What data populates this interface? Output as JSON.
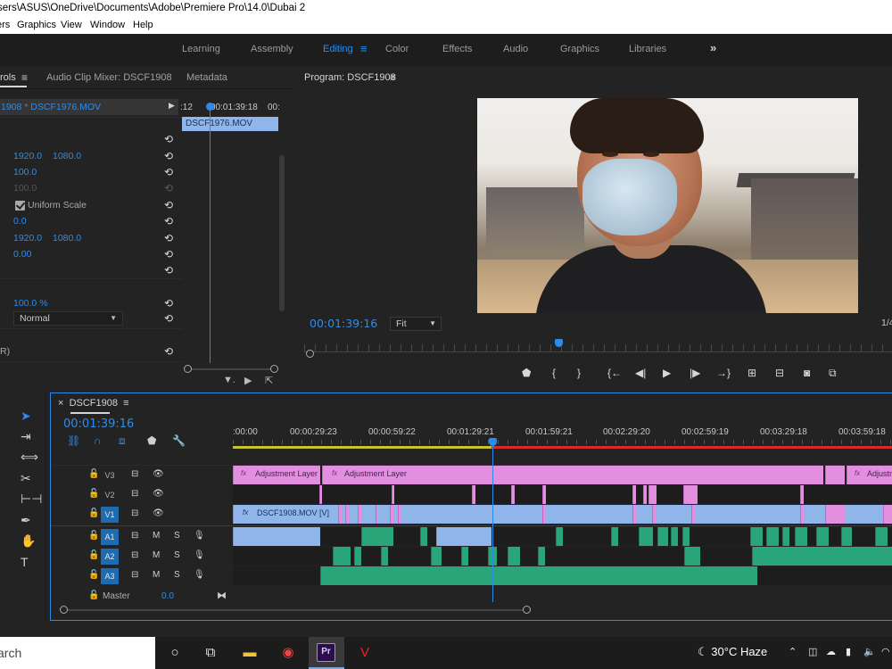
{
  "window": {
    "title": "sers\\ASUS\\OneDrive\\Documents\\Adobe\\Premiere Pro\\14.0\\Dubai 2"
  },
  "menu": [
    "ers",
    "Graphics",
    "View",
    "Window",
    "Help"
  ],
  "workspaces": {
    "tabs": [
      "Learning",
      "Assembly",
      "Editing",
      "Color",
      "Effects",
      "Audio",
      "Graphics",
      "Libraries"
    ],
    "active": "Editing",
    "more": "»"
  },
  "effect_controls": {
    "tab_label": "rols",
    "tabs": [
      "Audio Clip Mixer: DSCF1908",
      "Metadata"
    ],
    "clip_header": "1908 * DSCF1976.MOV",
    "position": [
      "1920.0",
      "1080.0"
    ],
    "scale": "100.0",
    "scale_width": "100.0",
    "uniform_scale": "Uniform Scale",
    "rotation": "0.0",
    "anchor": [
      "1920.0",
      "1080.0"
    ],
    "anti_flicker": "0.00",
    "opacity": "100.0 %",
    "blend_mode": "Normal",
    "bottom_label": "R)",
    "mini_timeline": {
      "labels": [
        ":12",
        "00:01:39:18",
        "00:"
      ],
      "clip": "DSCF1976.MOV"
    }
  },
  "program_monitor": {
    "title": "Program: DSCF1908",
    "timecode": "00:01:39:16",
    "zoom": "Fit",
    "fraction": "1/4"
  },
  "timeline": {
    "sequence": "DSCF1908",
    "timecode": "00:01:39:16",
    "ruler": [
      ":00:00",
      "00:00:29:23",
      "00:00:59:22",
      "00:01:29:21",
      "00:01:59:21",
      "00:02:29:20",
      "00:02:59:19",
      "00:03:29:18",
      "00:03:59:18"
    ],
    "tracks": {
      "v3": "V3",
      "v2": "V2",
      "v1": "V1",
      "a1": "A1",
      "a2": "A2",
      "a3": "A3",
      "mute": "M",
      "solo": "S"
    },
    "clips": {
      "adjustment": "Adjustment Layer",
      "adjustment_cut": "Adjustm",
      "video": "DSCF1908.MOV [V]",
      "fx": "fx"
    },
    "master": {
      "label": "Master",
      "value": "0.0"
    }
  },
  "taskbar": {
    "search": "arch",
    "weather": "30°C  Haze"
  },
  "colors": {
    "accent": "#2d8ceb",
    "adjustment_clip": "#e28fe0",
    "video_clip": "#8fb5ea",
    "audio_clip": "#2aa57a"
  }
}
